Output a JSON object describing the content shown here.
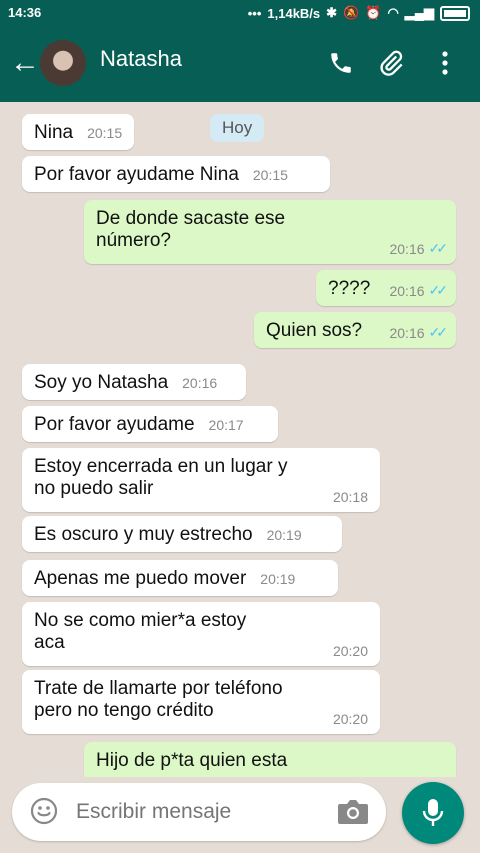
{
  "status_bar": {
    "time": "14:36",
    "network_speed": "1,14kB/s"
  },
  "header": {
    "contact_name": "Natasha"
  },
  "date_chip": "Hoy",
  "messages": [
    {
      "text": "Nina",
      "time": "20:15"
    },
    {
      "text": "Por favor ayudame Nina",
      "time": "20:15"
    },
    {
      "text_line1": "De donde sacaste ese",
      "text_line2": "número?",
      "time": "20:16"
    },
    {
      "text": "????",
      "time": "20:16"
    },
    {
      "text": "Quien sos?",
      "time": "20:16"
    },
    {
      "text": "Soy yo Natasha",
      "time": "20:16"
    },
    {
      "text": "Por favor ayudame",
      "time": "20:17"
    },
    {
      "text_line1": "Estoy encerrada en un lugar y",
      "text_line2": "no puedo salir",
      "time": "20:18"
    },
    {
      "text": "Es oscuro y muy estrecho",
      "time": "20:19"
    },
    {
      "text": "Apenas me puedo mover",
      "time": "20:19"
    },
    {
      "text_line1": "No se como mier*a estoy",
      "text_line2": "aca",
      "time": "20:20"
    },
    {
      "text_line1": "Trate de llamarte por teléfono",
      "text_line2": "pero no tengo crédito",
      "time": "20:20"
    },
    {
      "text": "Hijo de p*ta quien esta"
    }
  ],
  "composer": {
    "placeholder": "Escribir mensaje"
  },
  "colors": {
    "header": "#075e54",
    "incoming": "#ffffff",
    "outgoing": "#dcf8c6",
    "mic_button": "#00897b",
    "read_ticks": "#4fc3f7"
  },
  "icons": [
    "back-arrow-icon",
    "phone-icon",
    "paperclip-icon",
    "more-vert-icon",
    "emoji-icon",
    "camera-icon",
    "mic-icon"
  ]
}
